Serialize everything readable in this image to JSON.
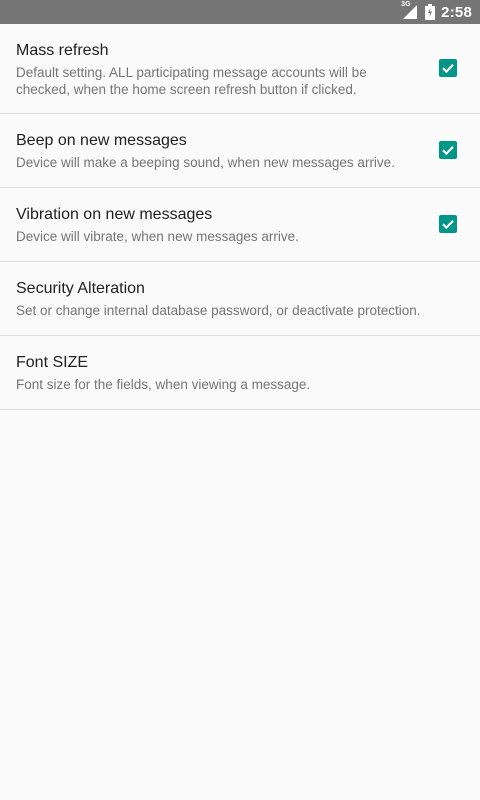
{
  "status_bar": {
    "network": "3G",
    "time": "2:58"
  },
  "settings": [
    {
      "title": "Mass refresh",
      "summary": "Default setting. ALL participating message accounts will be checked, when the home screen refresh button if clicked.",
      "checked": true
    },
    {
      "title": "Beep on new messages",
      "summary": "Device will make a beeping sound, when new messages arrive.",
      "checked": true
    },
    {
      "title": "Vibration on new messages",
      "summary": "Device will vibrate, when new messages arrive.",
      "checked": true
    },
    {
      "title": "Security Alteration",
      "summary": "Set or change internal database password, or deactivate protection."
    },
    {
      "title": "Font SIZE",
      "summary": "Font size for the fields, when viewing a message."
    }
  ],
  "colors": {
    "accent": "#009688",
    "status_bar": "#757575",
    "background": "#fafafa"
  }
}
